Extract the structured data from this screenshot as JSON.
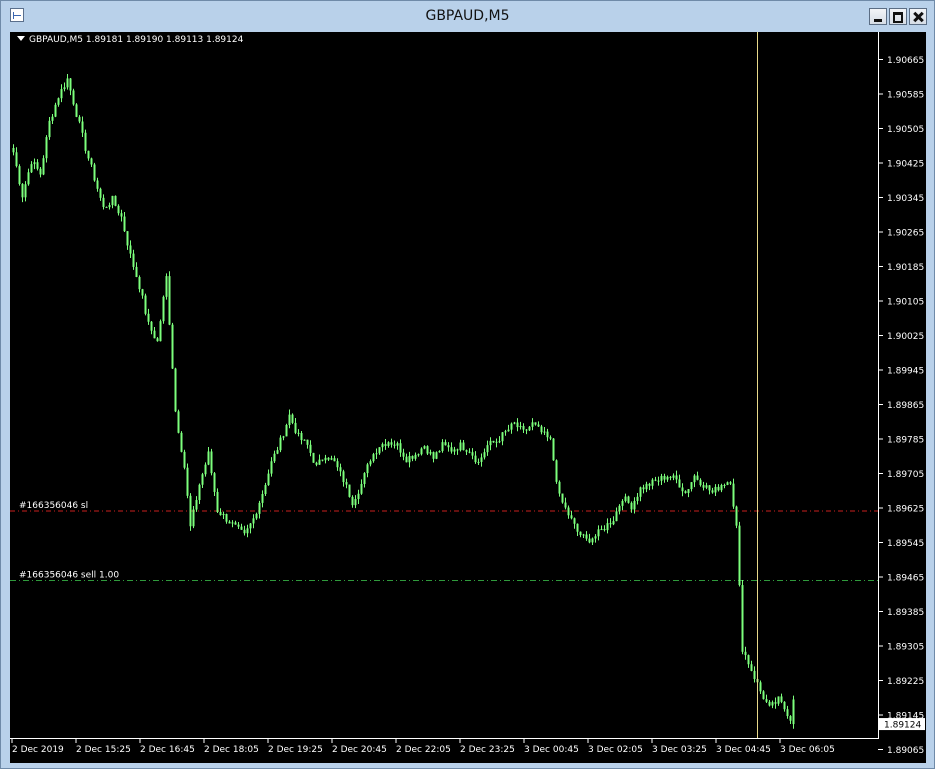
{
  "window": {
    "title": "GBPAUD,M5"
  },
  "chart_header": {
    "text": "GBPAUD,M5  1.89181 1.89190 1.89113 1.89124"
  },
  "price_axis": {
    "ticks": [
      "1.90665",
      "1.90585",
      "1.90505",
      "1.90425",
      "1.90345",
      "1.90265",
      "1.90185",
      "1.90105",
      "1.90025",
      "1.89945",
      "1.89865",
      "1.89785",
      "1.89705",
      "1.89625",
      "1.89545",
      "1.89465",
      "1.89385",
      "1.89305",
      "1.89225",
      "1.89145",
      "1.89065"
    ],
    "current_price": "1.89124"
  },
  "time_axis": {
    "labels": [
      "2 Dec 2019",
      "2 Dec 15:25",
      "2 Dec 16:45",
      "2 Dec 18:05",
      "2 Dec 19:25",
      "2 Dec 20:45",
      "2 Dec 22:05",
      "2 Dec 23:25",
      "3 Dec 00:45",
      "3 Dec 02:05",
      "3 Dec 03:25",
      "3 Dec 04:45",
      "3 Dec 06:05"
    ]
  },
  "order_lines": {
    "sl": {
      "label": "#166356046 sl",
      "price": 1.89618,
      "color": "#c8201e"
    },
    "entry": {
      "label": "#166356046 sell 1.00",
      "price": 1.89457,
      "color": "#2f9a3c"
    }
  },
  "colors": {
    "candle": "#7cff7c",
    "background": "#000000",
    "vline": "#e8d98a",
    "axis_text": "#ffffff"
  },
  "chart_data": {
    "type": "candlestick",
    "symbol": "GBPAUD",
    "timeframe": "M5",
    "last_ohlc": {
      "open": 1.89181,
      "high": 1.8919,
      "low": 1.89113,
      "close": 1.89124
    },
    "ylim": [
      1.89065,
      1.907
    ],
    "anchors": [
      [
        0,
        1.9045
      ],
      [
        3,
        1.9035
      ],
      [
        6,
        1.9043
      ],
      [
        9,
        1.904
      ],
      [
        12,
        1.9052
      ],
      [
        15,
        1.9058
      ],
      [
        18,
        1.9062
      ],
      [
        21,
        1.9054
      ],
      [
        24,
        1.9046
      ],
      [
        27,
        1.9039
      ],
      [
        30,
        1.9032
      ],
      [
        33,
        1.9034
      ],
      [
        36,
        1.903
      ],
      [
        39,
        1.9021
      ],
      [
        42,
        1.9014
      ],
      [
        45,
        1.9005
      ],
      [
        48,
        1.9001
      ],
      [
        51,
        1.9016
      ],
      [
        54,
        1.8985
      ],
      [
        57,
        1.8972
      ],
      [
        59,
        1.8958
      ],
      [
        62,
        1.8968
      ],
      [
        65,
        1.8975
      ],
      [
        68,
        1.8962
      ],
      [
        71,
        1.896
      ],
      [
        74,
        1.8958
      ],
      [
        77,
        1.8956
      ],
      [
        80,
        1.896
      ],
      [
        83,
        1.8966
      ],
      [
        86,
        1.8973
      ],
      [
        89,
        1.8978
      ],
      [
        92,
        1.8984
      ],
      [
        95,
        1.8979
      ],
      [
        98,
        1.8977
      ],
      [
        101,
        1.8972
      ],
      [
        104,
        1.8975
      ],
      [
        107,
        1.8973
      ],
      [
        110,
        1.8969
      ],
      [
        113,
        1.8964
      ],
      [
        116,
        1.8968
      ],
      [
        119,
        1.8974
      ],
      [
        122,
        1.8977
      ],
      [
        125,
        1.8978
      ],
      [
        128,
        1.8977
      ],
      [
        131,
        1.8974
      ],
      [
        134,
        1.8975
      ],
      [
        137,
        1.8977
      ],
      [
        140,
        1.8974
      ],
      [
        143,
        1.8977
      ],
      [
        146,
        1.8976
      ],
      [
        149,
        1.8977
      ],
      [
        152,
        1.8976
      ],
      [
        155,
        1.8973
      ],
      [
        158,
        1.8977
      ],
      [
        161,
        1.8978
      ],
      [
        164,
        1.898
      ],
      [
        167,
        1.8982
      ],
      [
        170,
        1.898
      ],
      [
        173,
        1.8982
      ],
      [
        176,
        1.898
      ],
      [
        179,
        1.8978
      ],
      [
        182,
        1.8965
      ],
      [
        185,
        1.8961
      ],
      [
        188,
        1.8957
      ],
      [
        191,
        1.8955
      ],
      [
        194,
        1.8956
      ],
      [
        197,
        1.8958
      ],
      [
        200,
        1.896
      ],
      [
        203,
        1.8965
      ],
      [
        206,
        1.8963
      ],
      [
        209,
        1.8967
      ],
      [
        212,
        1.8968
      ],
      [
        215,
        1.8969
      ],
      [
        218,
        1.897
      ],
      [
        221,
        1.8969
      ],
      [
        224,
        1.8966
      ],
      [
        227,
        1.897
      ],
      [
        230,
        1.8968
      ],
      [
        233,
        1.8966
      ],
      [
        236,
        1.8968
      ],
      [
        239,
        1.8969
      ],
      [
        241,
        1.8958
      ],
      [
        243,
        1.893
      ],
      [
        246,
        1.8925
      ],
      [
        249,
        1.892
      ],
      [
        252,
        1.8916
      ],
      [
        255,
        1.8918
      ],
      [
        258,
        1.8915
      ],
      [
        260,
        1.89124
      ]
    ]
  }
}
